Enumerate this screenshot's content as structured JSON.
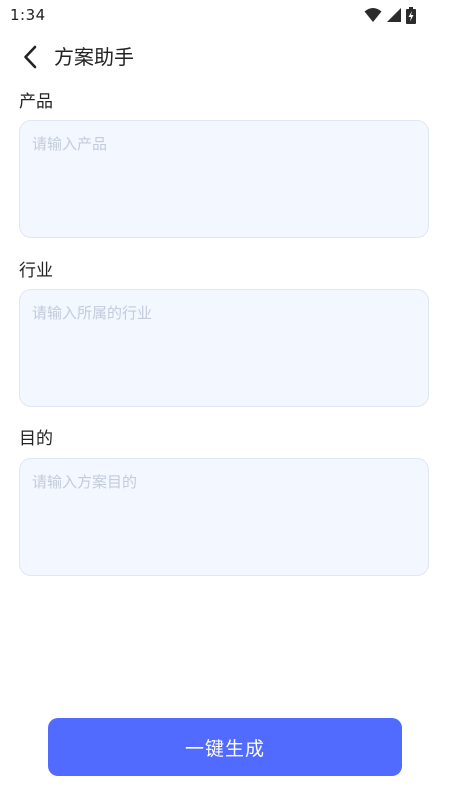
{
  "status_bar": {
    "time": "1:34"
  },
  "header": {
    "back_icon": "chevron-left-icon",
    "title": "方案助手"
  },
  "form": {
    "fields": [
      {
        "label": "产品",
        "placeholder": "请输入产品",
        "value": ""
      },
      {
        "label": "行业",
        "placeholder": "请输入所属的行业",
        "value": ""
      },
      {
        "label": "目的",
        "placeholder": "请输入方案目的",
        "value": ""
      }
    ]
  },
  "actions": {
    "generate_label": "一键生成"
  },
  "colors": {
    "accent": "#516aff",
    "input_background": "#f3f7ff",
    "input_border": "#dfe6f4",
    "placeholder": "#c3cbdc",
    "text": "#222222"
  }
}
